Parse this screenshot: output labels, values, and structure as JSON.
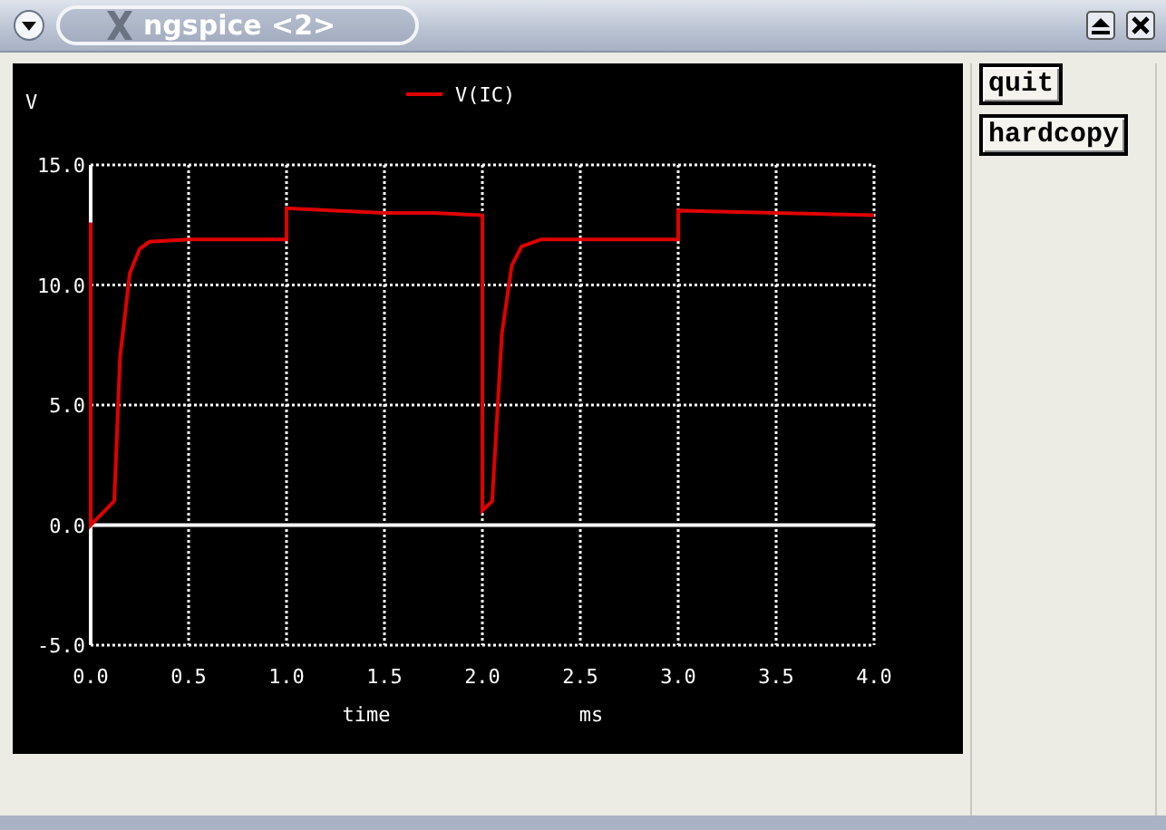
{
  "window": {
    "title": "ngspice <2>"
  },
  "plot": {
    "chart_data": {
      "type": "line",
      "xlabel": "time",
      "annotations": [
        {
          "text": "ms"
        }
      ],
      "grid": true,
      "ylabel": "V",
      "xlim": [
        0,
        4
      ],
      "ylim": [
        -5,
        15
      ],
      "xticks": [
        {
          "value": 0,
          "label": "0.0"
        },
        {
          "value": 0.5,
          "label": "0.5"
        },
        {
          "value": 1,
          "label": "1.0"
        },
        {
          "value": 1.5,
          "label": "1.5"
        },
        {
          "value": 2,
          "label": "2.0"
        },
        {
          "value": 2.5,
          "label": "2.5"
        },
        {
          "value": 3,
          "label": "3.0"
        },
        {
          "value": 3.5,
          "label": "3.5"
        },
        {
          "value": 4,
          "label": "4.0"
        }
      ],
      "yticks": [
        {
          "value": -5,
          "label": "-5.0"
        },
        {
          "value": 0,
          "label": "0.0"
        },
        {
          "value": 5,
          "label": "5.0"
        },
        {
          "value": 10,
          "label": "10.0"
        },
        {
          "value": 15,
          "label": "15.0"
        }
      ],
      "x": [
        0,
        0,
        0.12,
        0.15,
        0.2,
        0.25,
        0.3,
        0.5,
        1,
        1,
        1.25,
        1.5,
        1.75,
        2,
        2,
        2.05,
        2.1,
        2.15,
        2.2,
        2.3,
        2.5,
        3,
        3,
        3.5,
        4
      ],
      "series": [
        {
          "name": "V(IC)",
          "color": "#e00000",
          "values": [
            12.6,
            0,
            1.0,
            7,
            10.5,
            11.5,
            11.8,
            11.9,
            11.9,
            13.2,
            13.1,
            13.0,
            13.0,
            12.9,
            0.6,
            1.0,
            8,
            10.8,
            11.6,
            11.9,
            11.9,
            11.9,
            13.1,
            13.0,
            12.9
          ]
        }
      ]
    }
  },
  "buttons": [
    "quit",
    "hardcopy"
  ]
}
